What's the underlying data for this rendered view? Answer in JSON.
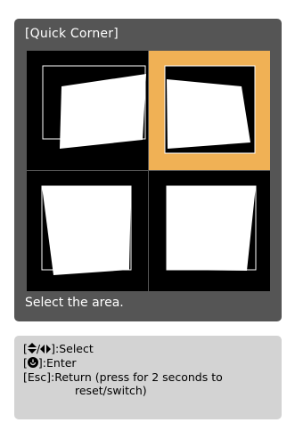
{
  "panel": {
    "title": "[Quick Corner]",
    "status_text": "Select the area.",
    "selected_area": "top-right",
    "colors": {
      "panel_bg": "#555555",
      "selected_bg": "#f0b155",
      "grid_bg": "#000000",
      "shape_fill": "#ffffff",
      "help_bg": "#d3d3d3"
    },
    "areas": [
      {
        "id": "top-left",
        "selected": false
      },
      {
        "id": "top-right",
        "selected": true
      },
      {
        "id": "bottom-left",
        "selected": false
      },
      {
        "id": "bottom-right",
        "selected": false
      }
    ]
  },
  "help": {
    "select": {
      "key_open": "[",
      "icon_a": "up-down-arrow-icon",
      "sep": "/",
      "icon_b": "left-right-arrow-icon",
      "key_close": "]",
      "action": ":Select"
    },
    "enter": {
      "key_open": "[",
      "icon": "enter-icon",
      "key_close": "]",
      "action": ":Enter"
    },
    "esc": {
      "key": "[Esc]",
      "action": ":Return (press for 2 seconds to",
      "action_cont": "reset/switch)"
    }
  }
}
